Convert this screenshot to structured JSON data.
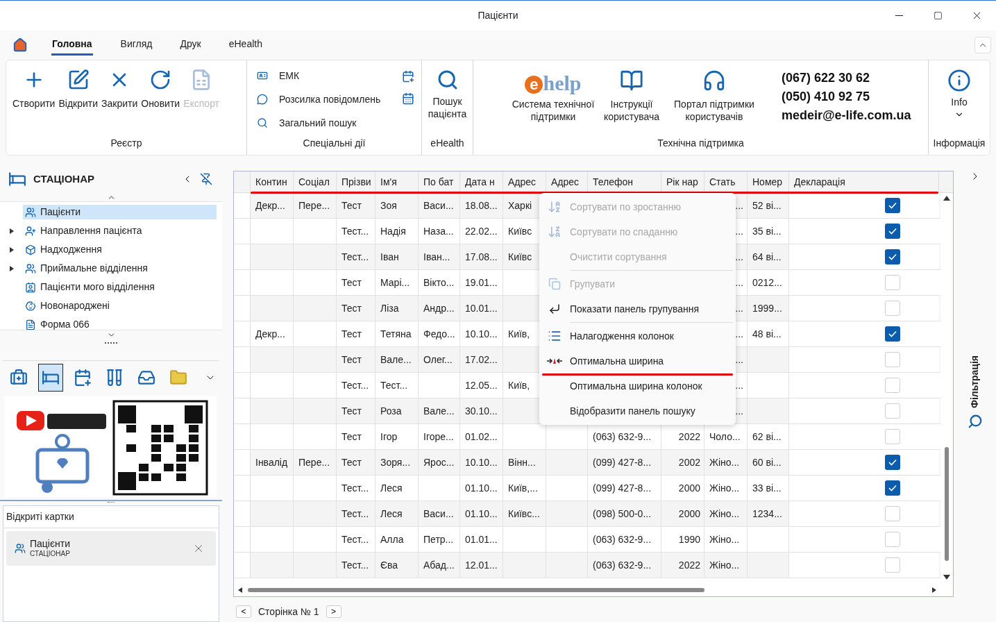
{
  "window": {
    "title": "Пацієнти"
  },
  "tabs": [
    {
      "label": "Головна",
      "selected": true
    },
    {
      "label": "Вигляд",
      "selected": false
    },
    {
      "label": "Друк",
      "selected": false
    },
    {
      "label": "eHealth",
      "selected": false
    }
  ],
  "ribbon": {
    "registry": {
      "title": "Реєстр",
      "buttons": [
        {
          "label": "Створити",
          "disabled": false
        },
        {
          "label": "Відкрити",
          "disabled": false
        },
        {
          "label": "Закрити",
          "disabled": false
        },
        {
          "label": "Оновити",
          "disabled": false
        },
        {
          "label": "Експорт",
          "disabled": true
        }
      ]
    },
    "special": {
      "title": "Спеціальні дії",
      "items": [
        "ЕМК",
        "Розсилка повідомлень",
        "Загальний пошук"
      ]
    },
    "ehealth": {
      "title": "eHealth",
      "button": "Пошук пацієнта"
    },
    "support": {
      "title": "Технічна підтримка",
      "logo_mark": "e",
      "logo_text": "help",
      "buttons": [
        "Система технічної підтримки",
        "Інструкції користувача",
        "Портал підтримки користувачів"
      ],
      "contacts": [
        "(067) 622 30 62",
        "(050) 410 92 75",
        "medeir@e-life.com.ua"
      ]
    },
    "info": {
      "title": "Інформація",
      "button": "Info"
    }
  },
  "sidebar": {
    "title": "СТАЦІОНАР",
    "tree": [
      {
        "label": "Пацієнти",
        "kind": "leaf",
        "selected": true
      },
      {
        "label": "Направлення пацієнта",
        "kind": "group",
        "expanded": false,
        "selected": false
      },
      {
        "label": "Надходження",
        "kind": "group",
        "expanded": false,
        "selected": false
      },
      {
        "label": "Приймальне відділення",
        "kind": "group",
        "expanded": false,
        "selected": false
      },
      {
        "label": "Пацієнти мого відділення",
        "kind": "leaf",
        "selected": false
      },
      {
        "label": "Новонароджені",
        "kind": "leaf",
        "selected": false
      },
      {
        "label": "Форма 066",
        "kind": "leaf",
        "selected": false
      }
    ],
    "modules": [
      {
        "selected": false
      },
      {
        "selected": true
      },
      {
        "selected": false
      },
      {
        "selected": false
      },
      {
        "selected": false
      },
      {
        "selected": false
      }
    ],
    "open_cards": {
      "title": "Відкриті картки",
      "cards": [
        {
          "title": "Пацієнти",
          "subtitle": "СТАЦІОНАР"
        }
      ]
    }
  },
  "table": {
    "underlined": true,
    "columns": [
      {
        "label": "Контин",
        "kind": "text"
      },
      {
        "label": "Соціал",
        "kind": "text"
      },
      {
        "label": "Прізви",
        "kind": "text"
      },
      {
        "label": "Ім'я",
        "kind": "text"
      },
      {
        "label": "По бат",
        "kind": "text"
      },
      {
        "label": "Дата н",
        "kind": "text"
      },
      {
        "label": "Адрес",
        "kind": "text"
      },
      {
        "label": "Адрес",
        "kind": "text"
      },
      {
        "label": "Телефон",
        "kind": "text"
      },
      {
        "label": "Рік нар",
        "kind": "number"
      },
      {
        "label": "Стать",
        "kind": "text"
      },
      {
        "label": "Номер",
        "kind": "text"
      },
      {
        "label": "Декларація",
        "kind": "check"
      }
    ],
    "rows": [
      {
        "cells": [
          "Декр...",
          "Пере...",
          "Тест",
          "Зоя",
          "Васи...",
          "18.08...",
          "Харкі",
          null,
          null,
          null,
          {
            "text": "...",
            "clipped": true
          },
          "52 ві..."
        ],
        "checked": true
      },
      {
        "cells": [
          null,
          null,
          "Тест...",
          "Надія",
          "Наза...",
          "22.02...",
          "Київс",
          null,
          null,
          null,
          {
            "text": "...",
            "clipped": true
          },
          "35 ві..."
        ],
        "checked": true
      },
      {
        "cells": [
          null,
          null,
          "Тест...",
          "Іван",
          "Іван...",
          "17.08...",
          "Київс",
          null,
          null,
          null,
          {
            "text": "...",
            "clipped": true
          },
          "64 ві..."
        ],
        "checked": true
      },
      {
        "cells": [
          null,
          null,
          "Тест",
          "Марі...",
          "Вікто...",
          "19.01...",
          null,
          null,
          null,
          null,
          {
            "text": "...",
            "clipped": true
          },
          "0212..."
        ],
        "checked": false
      },
      {
        "cells": [
          null,
          null,
          "Тест",
          "Ліза",
          "Андр...",
          "10.01...",
          null,
          null,
          null,
          null,
          {
            "text": "...",
            "clipped": true
          },
          "1999..."
        ],
        "checked": false
      },
      {
        "cells": [
          "Декр...",
          null,
          "Тест",
          "Тетяна",
          "Федо...",
          "10.10...",
          "Київ,",
          null,
          null,
          null,
          {
            "text": "...",
            "clipped": true
          },
          "48 ві..."
        ],
        "checked": true
      },
      {
        "cells": [
          null,
          null,
          "Тест",
          "Вале...",
          "Олег...",
          "17.02...",
          null,
          null,
          null,
          null,
          {
            "text": "...",
            "clipped": true
          },
          null
        ],
        "checked": false
      },
      {
        "cells": [
          null,
          null,
          "Тест...",
          "Тест...",
          null,
          "12.05...",
          "Київ,",
          null,
          null,
          null,
          {
            "text": "...",
            "clipped": true
          },
          null
        ],
        "checked": false
      },
      {
        "cells": [
          null,
          null,
          "Тест",
          "Роза",
          "Вале...",
          "30.10...",
          null,
          null,
          null,
          null,
          {
            "text": "...",
            "clipped": true
          },
          null
        ],
        "checked": false
      },
      {
        "cells": [
          null,
          null,
          "Тест",
          "Ігор",
          "Ігоре...",
          "01.02...",
          null,
          null,
          "(063) 632-9...",
          "2022",
          "Чоло...",
          "62 ві..."
        ],
        "checked": false
      },
      {
        "cells": [
          "Інвалід",
          "Пере...",
          "Тест",
          "Зоря...",
          "Ярос...",
          "10.10...",
          "Вінн...",
          null,
          "(099) 427-8...",
          "2002",
          "Жіно...",
          "60 ві..."
        ],
        "checked": true
      },
      {
        "cells": [
          null,
          null,
          "Тест...",
          "Леся",
          null,
          "01.10...",
          "Київ,...",
          null,
          "(099) 427-8...",
          "2000",
          "Жіно...",
          "33 ві..."
        ],
        "checked": true
      },
      {
        "cells": [
          null,
          null,
          "Тест...",
          "Леся",
          "Васи...",
          "01.10...",
          "Київс...",
          null,
          "(098) 500-0...",
          "2000",
          "Жіно...",
          "1234..."
        ],
        "checked": false
      },
      {
        "cells": [
          null,
          null,
          "Тест...",
          "Алла",
          "Петр...",
          "01.01...",
          null,
          null,
          "(063) 632-9...",
          "1990",
          "Жіно...",
          null
        ],
        "checked": false
      },
      {
        "cells": [
          null,
          null,
          "Тест...",
          "Єва",
          "Абад...",
          "12.01...",
          null,
          null,
          "(063) 632-9...",
          "2022",
          "Жіно...",
          null
        ],
        "checked": false
      }
    ]
  },
  "context_menu": [
    {
      "kind": "item",
      "label": "Сортувати по зростанню",
      "disabled": true,
      "underlined": false
    },
    {
      "kind": "item",
      "label": "Сортувати по спаданню",
      "disabled": true,
      "underlined": false
    },
    {
      "kind": "item",
      "label": "Очистити сортування",
      "disabled": true,
      "underlined": false
    },
    {
      "kind": "separator"
    },
    {
      "kind": "item",
      "label": "Групувати",
      "disabled": true,
      "underlined": false
    },
    {
      "kind": "item",
      "label": "Показати панель групування",
      "disabled": false,
      "underlined": false
    },
    {
      "kind": "separator"
    },
    {
      "kind": "item",
      "label": "Налагодження колонок",
      "disabled": false,
      "underlined": false
    },
    {
      "kind": "item",
      "label": "Оптимальна ширина",
      "disabled": false,
      "underlined": true
    },
    {
      "kind": "item",
      "label": "Оптимальна ширина колонок",
      "disabled": false,
      "underlined": false
    },
    {
      "kind": "item",
      "label": "Відобразити панель пошуку",
      "disabled": false,
      "underlined": false
    }
  ],
  "filter_panel": {
    "label": "Фільтрація"
  },
  "pager": {
    "prev": "<",
    "page": "Сторінка № 1",
    "next": ">"
  }
}
